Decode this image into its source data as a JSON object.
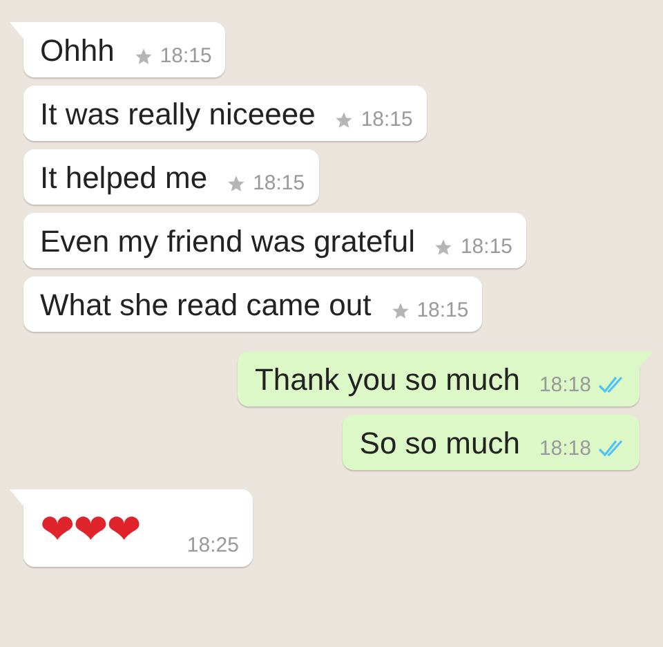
{
  "messages": [
    {
      "outgoing": false,
      "kind": "text",
      "text": "Ohhh",
      "time": "18:15",
      "starred": true,
      "tail": true
    },
    {
      "outgoing": false,
      "kind": "text",
      "text": "It was really niceeee",
      "time": "18:15",
      "starred": true,
      "tail": false
    },
    {
      "outgoing": false,
      "kind": "text",
      "text": "It helped me",
      "time": "18:15",
      "starred": true,
      "tail": false
    },
    {
      "outgoing": false,
      "kind": "text",
      "text": "Even my friend was grateful",
      "time": "18:15",
      "starred": true,
      "tail": false
    },
    {
      "outgoing": false,
      "kind": "text",
      "text": "What she read came out",
      "time": "18:15",
      "starred": true,
      "tail": false
    },
    {
      "outgoing": true,
      "kind": "text",
      "text": "Thank you so much",
      "time": "18:18",
      "read": true,
      "tail": true
    },
    {
      "outgoing": true,
      "kind": "text",
      "text": "So so much",
      "time": "18:18",
      "read": true,
      "tail": false
    },
    {
      "outgoing": false,
      "kind": "emoji",
      "text": "❤❤❤",
      "time": "18:25",
      "starred": false,
      "tail": true
    }
  ]
}
